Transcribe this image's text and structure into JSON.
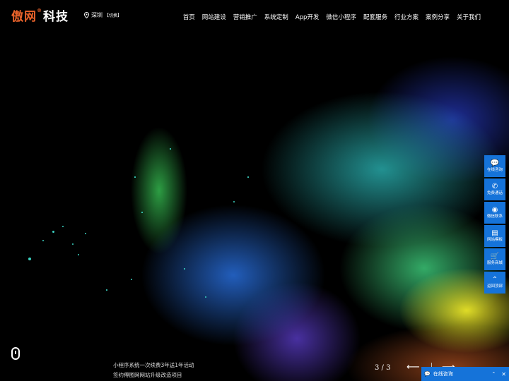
{
  "header": {
    "logo_part1": "傲网",
    "logo_reg": "®",
    "logo_part2": "科技",
    "city": "深圳",
    "city_switch": "【切换】",
    "nav": [
      "首页",
      "网站建设",
      "营销推广",
      "系统定制",
      "App开发",
      "微信小程序",
      "配套服务",
      "行业方案",
      "案例分享",
      "关于我们"
    ]
  },
  "side_tools": [
    {
      "icon": "chat-bubble-icon",
      "glyph": "💬",
      "label": "在线咨询"
    },
    {
      "icon": "phone-icon",
      "glyph": "✆",
      "label": "免费通话"
    },
    {
      "icon": "wechat-icon",
      "glyph": "◉",
      "label": "微信联系"
    },
    {
      "icon": "template-icon",
      "glyph": "▤",
      "label": "网站模板"
    },
    {
      "icon": "cart-icon",
      "glyph": "🛒",
      "label": "服务商城"
    },
    {
      "icon": "up-arrow-icon",
      "glyph": "⌃",
      "label": "返回顶部"
    }
  ],
  "news": [
    "小程序系统一次续费3年送1年活动",
    "签约傅图网网站升级改造项目"
  ],
  "pager": {
    "text": "3 / 3",
    "prev_glyph": "⟵",
    "next_glyph": "⟶"
  },
  "chat_bar": {
    "label": "在线咨询",
    "expand_glyph": "⌃",
    "close_glyph": "✕"
  },
  "colors": {
    "accent": "#1573d9",
    "logo_orange": "#e8622a"
  }
}
